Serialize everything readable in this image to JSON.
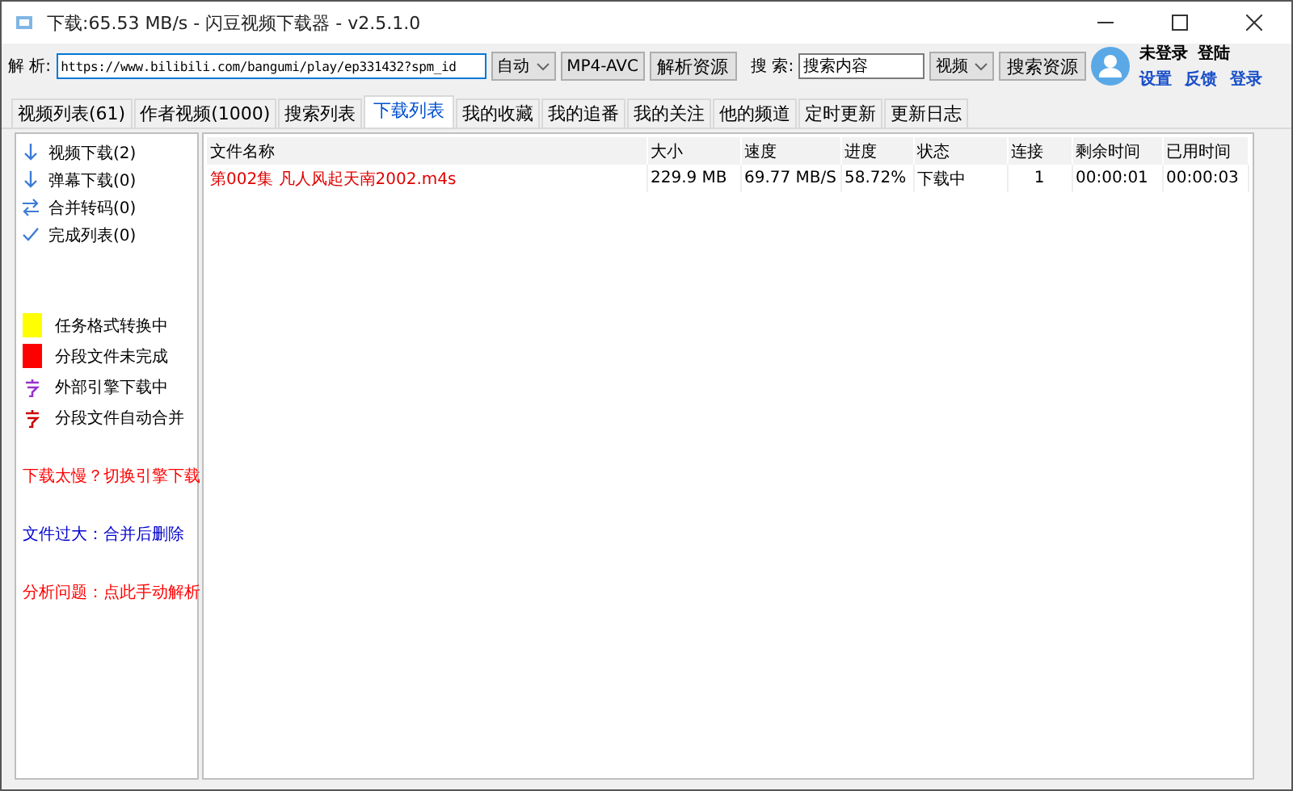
{
  "window": {
    "title": "下载:65.53 MB/s - 闪豆视频下载器 - v2.5.1.0"
  },
  "toolbar": {
    "parse_label": "解 析:",
    "url": "https://www.bilibili.com/bangumi/play/ep331432?spm_id",
    "mode": "自动",
    "codec": "MP4-AVC",
    "parse_button": "解析资源",
    "search_label": "搜 索:",
    "search_placeholder": "搜索内容",
    "search_type": "视频",
    "search_button": "搜索资源"
  },
  "account": {
    "status": "未登录",
    "login_hint": "登陆",
    "links": [
      "设置",
      "反馈",
      "登录"
    ]
  },
  "tabs": [
    {
      "label": "视频列表(61)",
      "selected": false
    },
    {
      "label": "作者视频(1000)",
      "selected": false
    },
    {
      "label": "搜索列表",
      "selected": false
    },
    {
      "label": "下载列表",
      "selected": true
    },
    {
      "label": "我的收藏",
      "selected": false
    },
    {
      "label": "我的追番",
      "selected": false
    },
    {
      "label": "我的关注",
      "selected": false
    },
    {
      "label": "他的频道",
      "selected": false
    },
    {
      "label": "定时更新",
      "selected": false
    },
    {
      "label": "更新日志",
      "selected": false
    }
  ],
  "sidebar": {
    "items": [
      {
        "label": "视频下载(2)",
        "kind": "download"
      },
      {
        "label": "弹幕下载(0)",
        "kind": "download"
      },
      {
        "label": "合并转码(0)",
        "kind": "convert"
      },
      {
        "label": "完成列表(0)",
        "kind": "done"
      }
    ],
    "legend": [
      {
        "label": "任务格式转换中",
        "kind": "swatch",
        "color": "#ffff00"
      },
      {
        "label": "分段文件未完成",
        "kind": "swatch",
        "color": "#ff0000"
      },
      {
        "label": "外部引擎下载中",
        "kind": "glyph",
        "color": "#9933cc"
      },
      {
        "label": "分段文件自动合并",
        "kind": "glyph",
        "color": "#cc0000"
      }
    ],
    "links": [
      {
        "label": "下载太慢？切换引擎下载",
        "color": "#ff0000"
      },
      {
        "label": "文件过大：合并后删除",
        "color": "#0000cc"
      },
      {
        "label": "分析问题：点此手动解析",
        "color": "#ff0000"
      }
    ]
  },
  "table": {
    "columns": [
      "文件名称",
      "大小",
      "速度",
      "进度",
      "状态",
      "连接",
      "剩余时间",
      "已用时间"
    ],
    "rows": [
      [
        "第002集 凡人风起天南2002.m4s",
        "229.9 MB",
        "69.77 MB/S",
        "58.72%",
        "下载中",
        "1",
        "00:00:01",
        "00:00:03"
      ]
    ]
  }
}
